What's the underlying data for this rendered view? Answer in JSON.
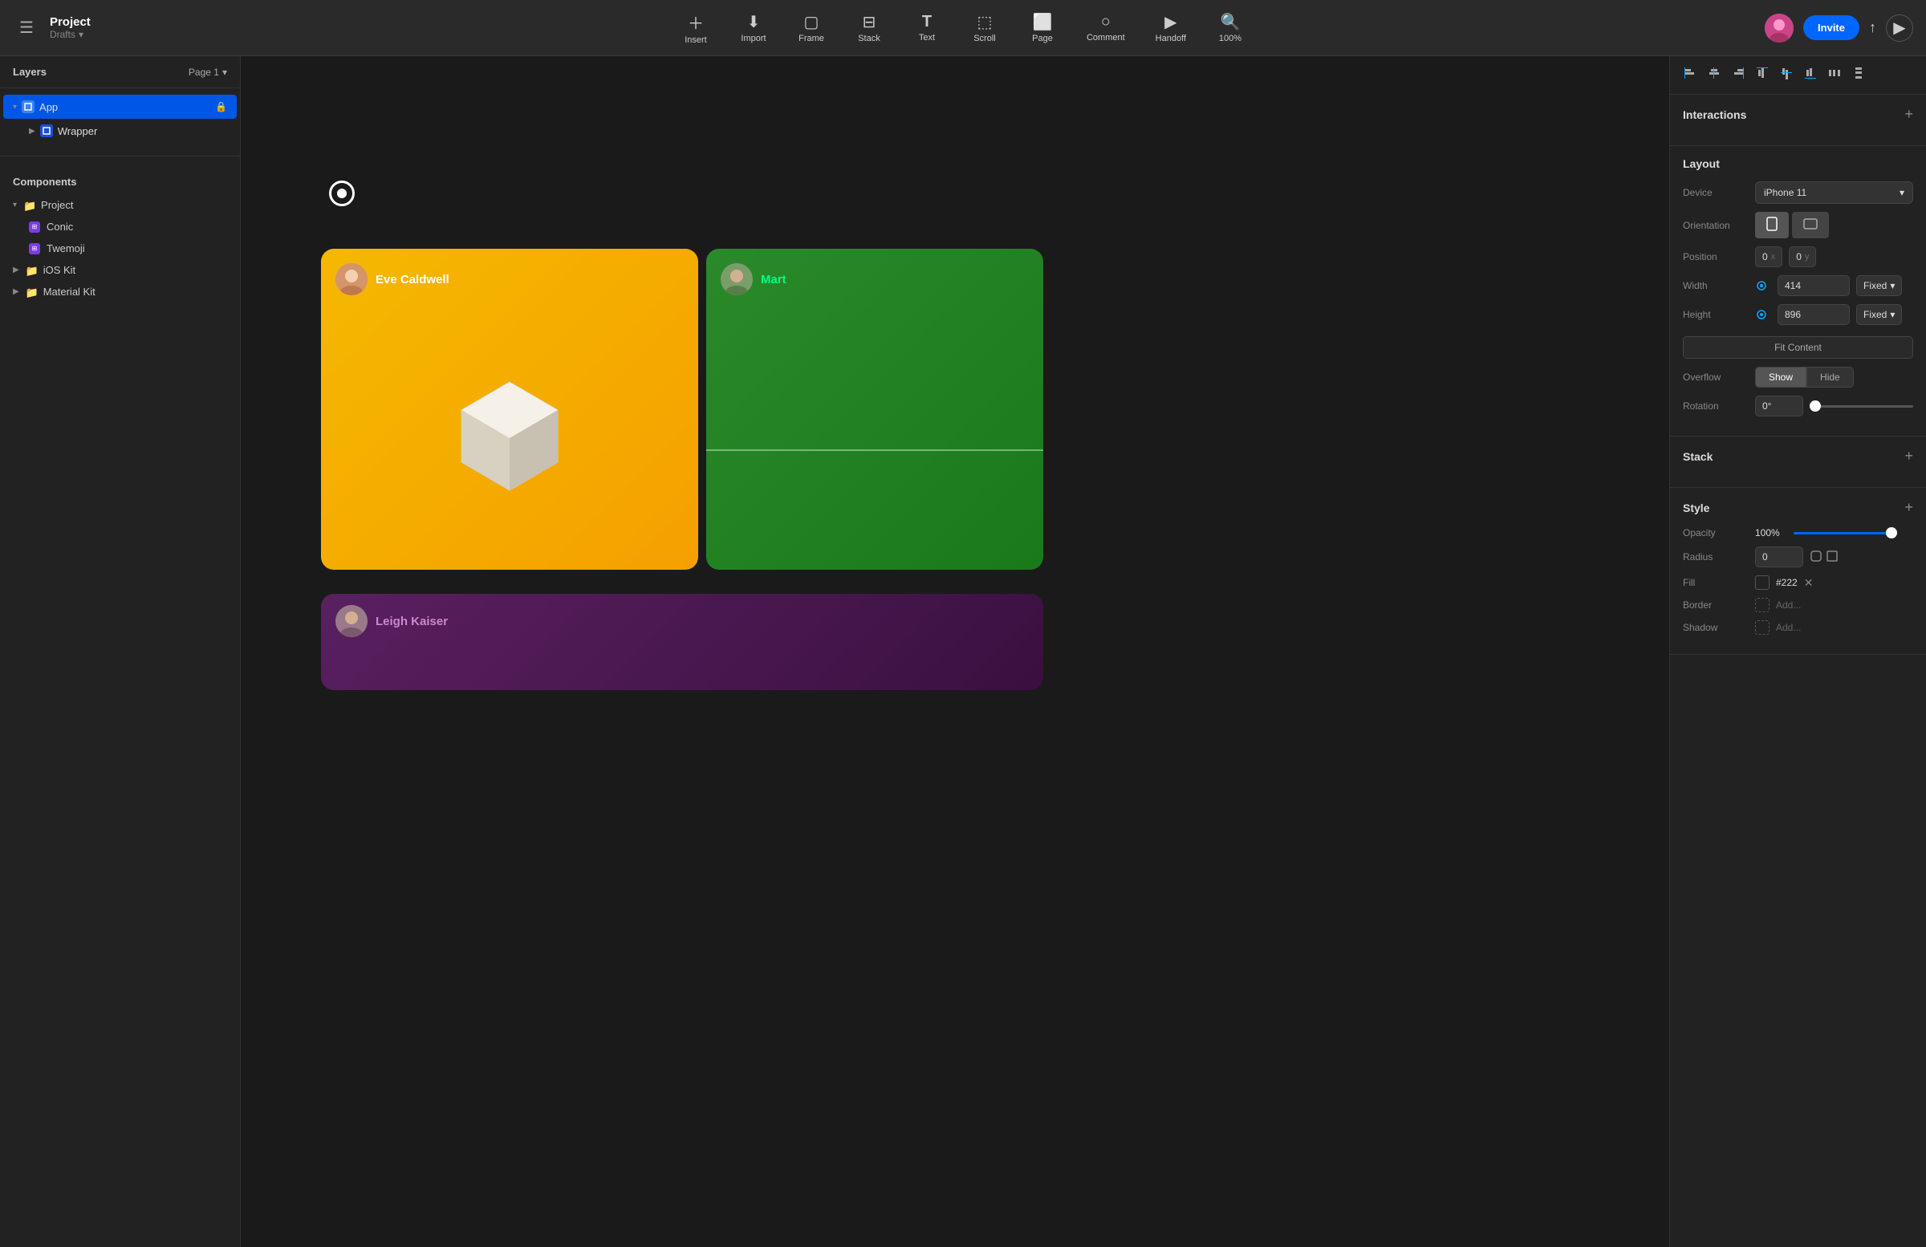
{
  "toolbar": {
    "hamburger": "☰",
    "project_name": "Project",
    "project_sub": "Drafts",
    "chevron_down": "▾",
    "tools": [
      {
        "id": "insert",
        "icon": "+",
        "label": "Insert"
      },
      {
        "id": "import",
        "icon": "↓",
        "label": "Import"
      },
      {
        "id": "frame",
        "icon": "⊡",
        "label": "Frame"
      },
      {
        "id": "stack",
        "icon": "⊟",
        "label": "Stack"
      },
      {
        "id": "text",
        "icon": "T",
        "label": "Text"
      },
      {
        "id": "scroll",
        "icon": "⬚",
        "label": "Scroll"
      },
      {
        "id": "page",
        "icon": "⬜",
        "label": "Page"
      },
      {
        "id": "comment",
        "icon": "○",
        "label": "Comment"
      },
      {
        "id": "handoff",
        "icon": "▶",
        "label": "Handoff"
      }
    ],
    "zoom": "100%",
    "invite_label": "Invite",
    "upload_icon": "↑",
    "play_icon": "▶"
  },
  "sidebar": {
    "layers_title": "Layers",
    "page_label": "Page 1",
    "chevron": "▾",
    "layers": [
      {
        "id": "app",
        "name": "App",
        "type": "frame",
        "selected": true,
        "expanded": true,
        "indent": 0,
        "lock": true
      },
      {
        "id": "wrapper",
        "name": "Wrapper",
        "type": "frame",
        "selected": false,
        "expanded": false,
        "indent": 1,
        "lock": false
      }
    ],
    "components_title": "Components",
    "components": [
      {
        "id": "project",
        "name": "Project",
        "type": "folder",
        "indent": 0
      },
      {
        "id": "conic",
        "name": "Conic",
        "type": "component",
        "indent": 1
      },
      {
        "id": "twemoji",
        "name": "Twemoji",
        "type": "component",
        "indent": 1
      },
      {
        "id": "ios-kit",
        "name": "iOS Kit",
        "type": "folder",
        "indent": 0
      },
      {
        "id": "material-kit",
        "name": "Material Kit",
        "type": "folder",
        "indent": 0
      }
    ]
  },
  "canvas": {
    "card1_user": "Eve Caldwell",
    "card2_user": "Mart",
    "card3_user": "Leigh Kaiser",
    "record_dot": "●"
  },
  "right_panel": {
    "align_icons": [
      "⊢",
      "+",
      "⊣",
      "⊤",
      "↕",
      "⊥",
      "|",
      "≡"
    ],
    "interactions_title": "Interactions",
    "add_icon": "+",
    "layout_title": "Layout",
    "device_label": "Device",
    "device_value": "iPhone 11",
    "device_chevron": "▾",
    "orientation_label": "Orientation",
    "orient_portrait": "▯",
    "orient_landscape": "▭",
    "position_label": "Position",
    "pos_x": "0",
    "pos_x_label": "x",
    "pos_y": "0",
    "pos_y_label": "y",
    "width_label": "Width",
    "width_value": "414",
    "width_fixed": "Fixed",
    "height_label": "Height",
    "height_value": "896",
    "height_fixed": "Fixed",
    "fit_content": "Fit Content",
    "overflow_label": "Overflow",
    "overflow_show": "Show",
    "overflow_hide": "Hide",
    "rotation_label": "Rotation",
    "rotation_value": "0°",
    "stack_title": "Stack",
    "style_title": "Style",
    "opacity_label": "Opacity",
    "opacity_value": "100%",
    "radius_label": "Radius",
    "radius_value": "0",
    "fill_label": "Fill",
    "fill_value": "#222",
    "border_label": "Border",
    "border_add": "Add...",
    "shadow_label": "Shadow",
    "shadow_add": "Add..."
  }
}
